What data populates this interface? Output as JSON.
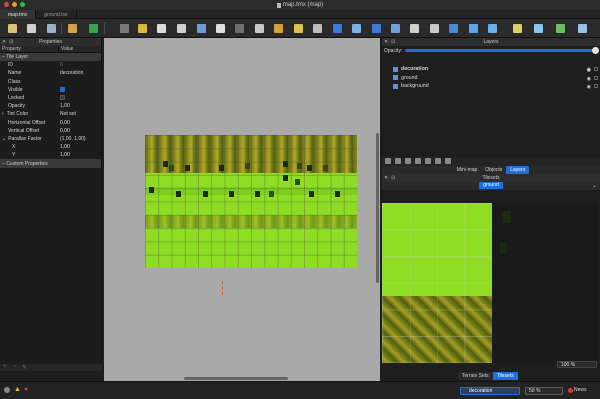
{
  "window": {
    "title": "map.tmx (map)"
  },
  "tabs": [
    {
      "label": "map.tmx",
      "active": true
    },
    {
      "label": "ground.tsx",
      "active": false
    }
  ],
  "properties_panel": {
    "title": "Properties",
    "columns": [
      "Property",
      "Value"
    ],
    "group_tile_layer": "Tile Layer",
    "rows": [
      {
        "name": "ID",
        "value": "6"
      },
      {
        "name": "Name",
        "value": "decoration"
      },
      {
        "name": "Class",
        "value": ""
      },
      {
        "name": "Visible",
        "value": "checked"
      },
      {
        "name": "Locked",
        "value": "unchecked"
      },
      {
        "name": "Opacity",
        "value": "1,00"
      },
      {
        "name": "Tint Color",
        "value": "Not set"
      },
      {
        "name": "Horizontal Offset",
        "value": "0,00"
      },
      {
        "name": "Vertical Offset",
        "value": "0,00"
      },
      {
        "name": "Parallax Factor",
        "value": "(1,00, 1,00)"
      },
      {
        "name": "X",
        "value": "1,00"
      },
      {
        "name": "Y",
        "value": "1,00"
      }
    ],
    "group_custom": "Custom Properties"
  },
  "layers_panel": {
    "title": "Layers",
    "opacity_label": "Opacity:",
    "layers": [
      {
        "name": "decoration",
        "selected": true
      },
      {
        "name": "ground",
        "selected": false
      },
      {
        "name": "background",
        "selected": false
      }
    ],
    "tabs": [
      "Mini-map",
      "Objects",
      "Layers"
    ],
    "active_tab": "Layers"
  },
  "tilesets_panel": {
    "title": "Tilesets",
    "active_tileset": "ground",
    "zoom": "100 %"
  },
  "bottom_tabs": [
    "Terrain Sets",
    "Tilesets"
  ],
  "status_bar": {
    "current_layer": "decoration",
    "zoom": "50 %",
    "news": "News"
  },
  "colors": {
    "accent": "#1d6fe0",
    "grass": "#8fdd22",
    "foliage": "#6f7a18",
    "canvas_bg": "#a9a9a9"
  }
}
